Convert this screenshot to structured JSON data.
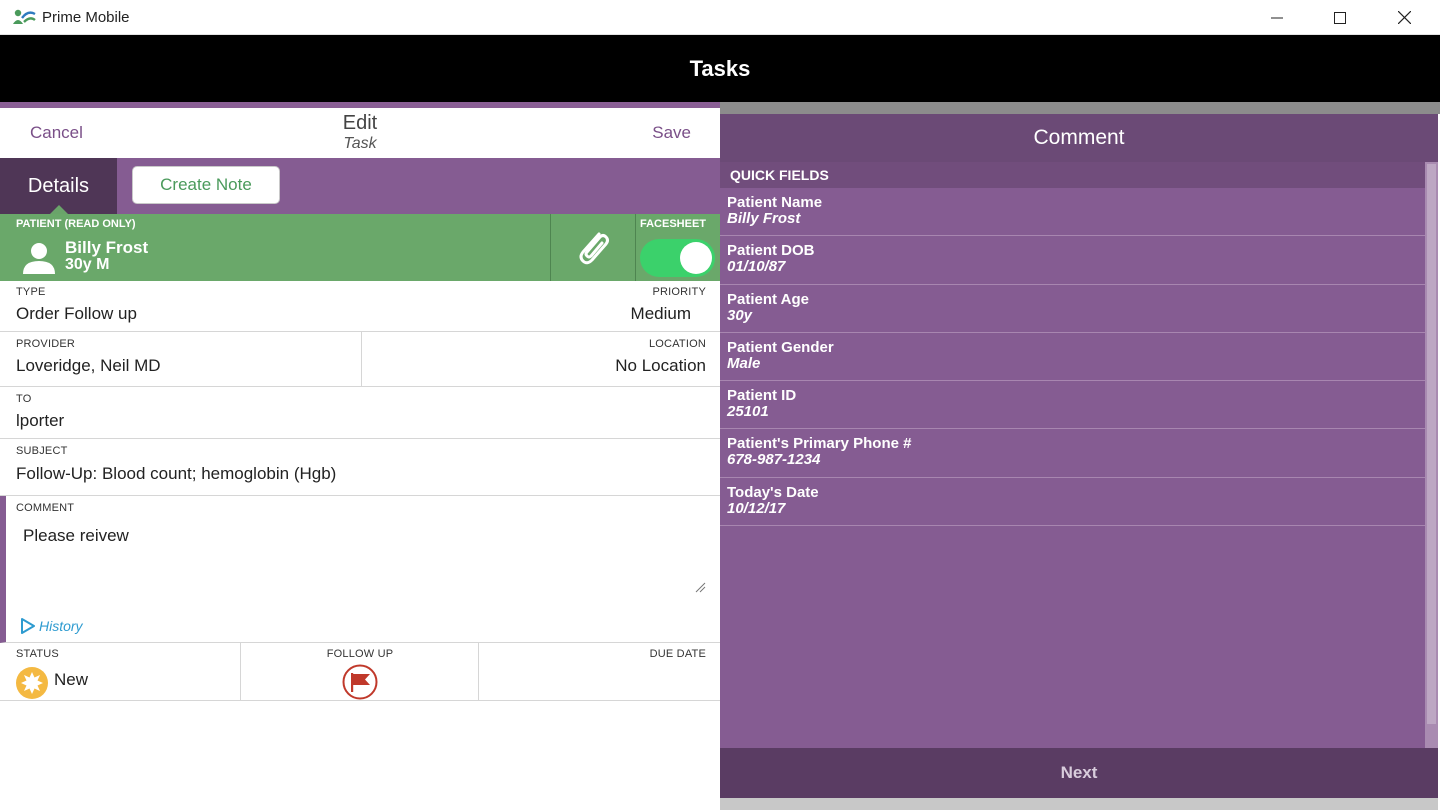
{
  "window": {
    "title": "Prime Mobile",
    "app_icon": "prime-mobile-logo-icon"
  },
  "header": {
    "title": "Tasks"
  },
  "edit_bar": {
    "cancel_label": "Cancel",
    "title": "Edit",
    "subtitle": "Task",
    "save_label": "Save"
  },
  "tabs": {
    "details_label": "Details",
    "create_note_label": "Create Note"
  },
  "patient": {
    "label": "PATIENT (READ ONLY)",
    "name": "Billy Frost",
    "info": "30y M",
    "facesheet_label": "FACESHEET",
    "facesheet_on": true
  },
  "fields": {
    "type_label": "TYPE",
    "type_value": "Order Follow up",
    "priority_label": "PRIORITY",
    "priority_value": "Medium",
    "provider_label": "PROVIDER",
    "provider_value": "Loveridge, Neil MD",
    "location_label": "LOCATION",
    "location_value": "No Location",
    "to_label": "TO",
    "to_value": "lporter",
    "subject_label": "SUBJECT",
    "subject_value": "Follow-Up:  Blood count; hemoglobin (Hgb)",
    "comment_label": "COMMENT",
    "comment_value": "Please reivew",
    "history_label": "History",
    "status_label": "STATUS",
    "status_value": "New",
    "follow_up_label": "FOLLOW UP",
    "due_date_label": "DUE DATE"
  },
  "comment_panel": {
    "title": "Comment",
    "quick_fields_label": "QUICK FIELDS",
    "items": [
      {
        "name": "Patient Name",
        "value": "Billy Frost"
      },
      {
        "name": "Patient DOB",
        "value": "01/10/87"
      },
      {
        "name": "Patient Age",
        "value": "30y"
      },
      {
        "name": "Patient Gender",
        "value": "Male"
      },
      {
        "name": "Patient ID",
        "value": "25101"
      },
      {
        "name": "Patient's Primary Phone #",
        "value": "678-987-1234"
      },
      {
        "name": "Today's Date",
        "value": "10/12/17"
      }
    ],
    "next_label": "Next"
  },
  "colors": {
    "header": "#000000",
    "accent_purple": "#855c92",
    "patient_green": "#6aa86a",
    "toggle_on": "#3bd16b",
    "create_note_text": "#4a9a5b",
    "history_link": "#2e9bd0",
    "flag_red": "#c0392b",
    "status_new": "#f4b942"
  }
}
